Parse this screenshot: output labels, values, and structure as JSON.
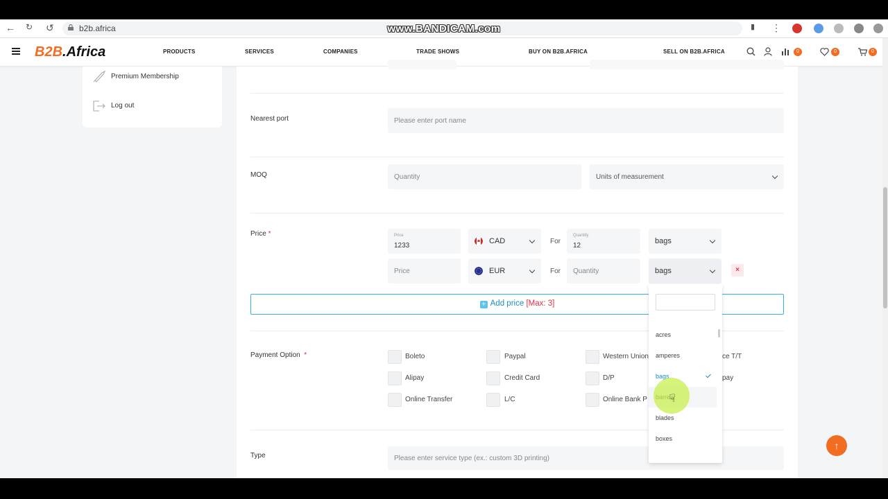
{
  "browser": {
    "url": "b2b.africa",
    "watermark": "www.BANDICAM.com"
  },
  "header": {
    "logo_b2b": "B2B",
    "logo_africa": ".Africa",
    "nav": [
      "PRODUCTS",
      "SERVICES",
      "COMPANIES",
      "TRADE SHOWS",
      "BUY ON B2B.AFRICA",
      "SELL ON B2B.AFRICA"
    ],
    "badges": {
      "compare": "0",
      "wishlist": "0",
      "cart": "0"
    }
  },
  "sidebar": {
    "items": [
      {
        "label": "Premium Membership"
      },
      {
        "label": "Log out"
      }
    ]
  },
  "form": {
    "nearest_port": {
      "label": "Nearest port",
      "placeholder": "Please enter port name"
    },
    "moq": {
      "label": "MOQ",
      "quantity_placeholder": "Quantity",
      "units_placeholder": "Units of measurement"
    },
    "price": {
      "label": "Price",
      "required_mark": "*",
      "for_label": "For",
      "rows": [
        {
          "price_label": "Price",
          "price_value": "1233",
          "currency": "CAD",
          "qty_label": "Quantity",
          "qty_value": "12",
          "unit": "bags"
        },
        {
          "price_placeholder": "Price",
          "currency": "EUR",
          "qty_placeholder": "Quantity",
          "unit": "bags"
        }
      ],
      "add_price": "Add price",
      "add_price_max": "[Max: 3]",
      "remove": "×"
    },
    "payment": {
      "label": "Payment Option",
      "required_mark": "*",
      "options": [
        "Boleto",
        "Paypal",
        "Western Union",
        "Alipay",
        "Credit Card",
        "D/P",
        "Online Transfer",
        "L/C",
        "Online Bank P"
      ],
      "partial_right": [
        "ce T/T",
        "pay"
      ]
    },
    "type": {
      "label": "Type",
      "placeholder": "Please enter service type (ex.: custom 3D printing)"
    }
  },
  "dropdown": {
    "items": [
      {
        "label": "acres"
      },
      {
        "label": "amperes"
      },
      {
        "label": "bags",
        "selected": true
      },
      {
        "label": "barrels",
        "hovered": true
      },
      {
        "label": "blades"
      },
      {
        "label": "boxes"
      }
    ]
  },
  "colors": {
    "brand": "#f26d21",
    "accent": "#1a8fc4",
    "required": "#e02a4a"
  }
}
